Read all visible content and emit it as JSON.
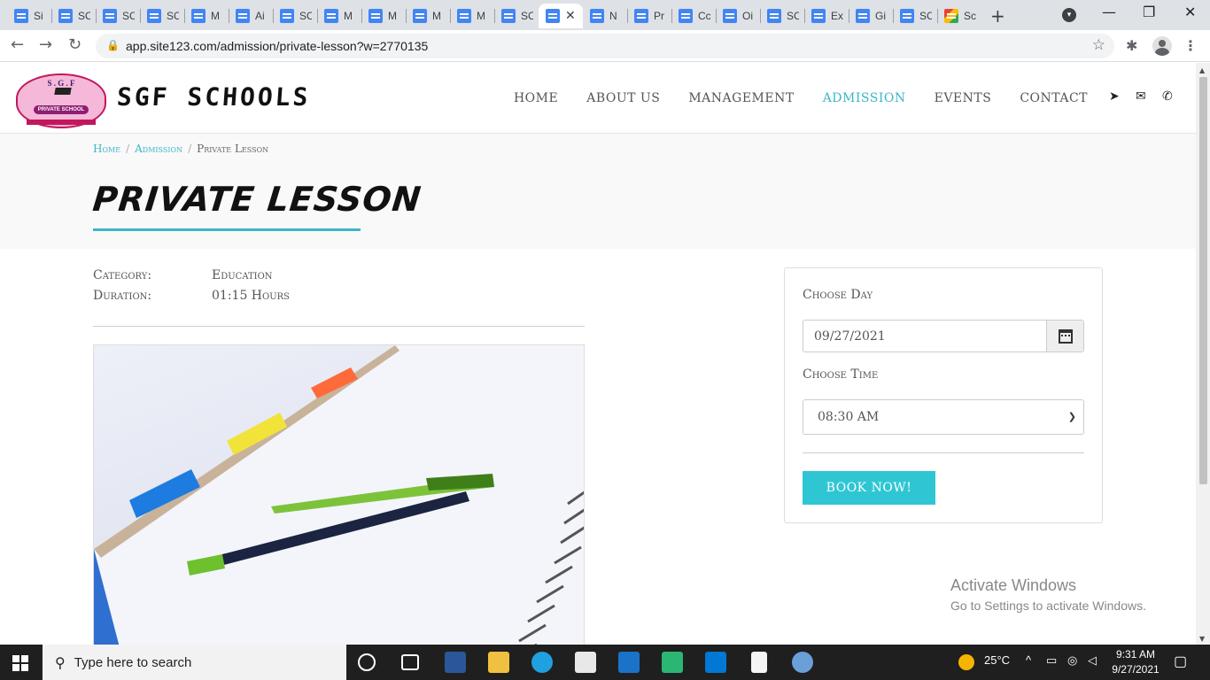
{
  "browser": {
    "tabs": [
      {
        "label": "Si"
      },
      {
        "label": "SC"
      },
      {
        "label": "SC"
      },
      {
        "label": "SC"
      },
      {
        "label": "M"
      },
      {
        "label": "Ai"
      },
      {
        "label": "SC"
      },
      {
        "label": "M"
      },
      {
        "label": "M"
      },
      {
        "label": "M"
      },
      {
        "label": "M"
      },
      {
        "label": "SC"
      },
      {
        "label": ""
      },
      {
        "label": "N"
      },
      {
        "label": "Pr"
      },
      {
        "label": "Cc"
      },
      {
        "label": "Oi"
      },
      {
        "label": "SC"
      },
      {
        "label": "Ex"
      },
      {
        "label": "Gi"
      },
      {
        "label": "SC"
      },
      {
        "label": "Sc"
      }
    ],
    "url": "app.site123.com/admission/private-lesson?w=2770135"
  },
  "site": {
    "logo_top": "S . G . F",
    "logo_band": "PRIVATE SCHOOL",
    "name": "SGF SCHOOLS",
    "nav": [
      {
        "label": "HOME"
      },
      {
        "label": "ABOUT US"
      },
      {
        "label": "MANAGEMENT"
      },
      {
        "label": "ADMISSION"
      },
      {
        "label": "EVENTS"
      },
      {
        "label": "CONTACT"
      }
    ],
    "accent": "#3cb6c8"
  },
  "breadcrumb": {
    "home": "Home",
    "admission": "Admission",
    "current": "Private Lesson"
  },
  "page": {
    "title": "PRIVATE LESSON",
    "category_label": "Category:",
    "category_value": "Education",
    "duration_label": "Duration:",
    "duration_value": "01:15 Hours"
  },
  "booking": {
    "day_label": "Choose Day",
    "day_value": "09/27/2021",
    "time_label": "Choose Time",
    "time_value": "08:30 AM",
    "button": "BOOK NOW!",
    "button_color": "#2fc6d4"
  },
  "watermark": {
    "line1": "Activate Windows",
    "line2": "Go to Settings to activate Windows."
  },
  "taskbar": {
    "search_placeholder": "Type here to search",
    "weather": "25°C",
    "time": "9:31 AM",
    "date": "9/27/2021"
  }
}
